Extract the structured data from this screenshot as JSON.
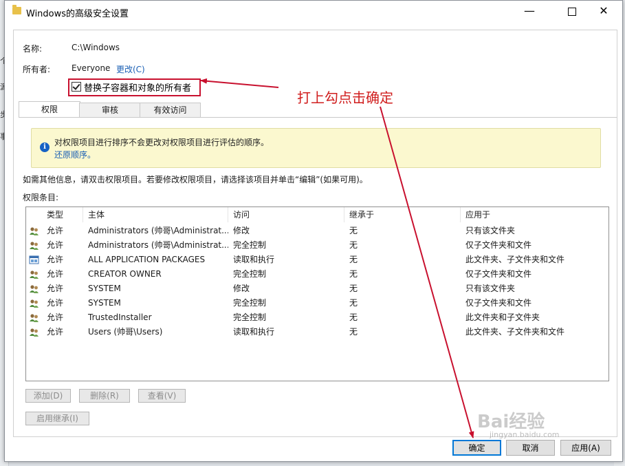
{
  "window": {
    "title": "Windows的高级安全设置",
    "controls": {
      "minimize": "—",
      "close": "✕"
    }
  },
  "background_fragments": [
    "个",
    "源",
    "步",
    "事"
  ],
  "header": {
    "name_label": "名称:",
    "name_value": "C:\\Windows",
    "owner_label": "所有者:",
    "owner_value": "Everyone",
    "change_link": "更改(C)",
    "replace_owner_checkbox": {
      "label": "替换子容器和对象的所有者",
      "checked": true
    }
  },
  "tabs": [
    {
      "label": "权限",
      "active": true
    },
    {
      "label": "审核",
      "active": false
    },
    {
      "label": "有效访问",
      "active": false
    }
  ],
  "info_box": {
    "icon": "info-icon",
    "text": "对权限项目进行排序不会更改对权限项目进行评估的顺序。",
    "link": "还原顺序。"
  },
  "instructions": "如需其他信息，请双击权限项目。若要修改权限项目，请选择该项目并单击“编辑”(如果可用)。",
  "entries_label": "权限条目:",
  "table": {
    "columns": [
      "类型",
      "主体",
      "访问",
      "继承于",
      "应用于"
    ],
    "rows": [
      {
        "icon": "user-group-icon",
        "type": "允许",
        "principal": "Administrators (帅哥\\Administrat...",
        "access": "修改",
        "inherited": "无",
        "applies": "只有该文件夹"
      },
      {
        "icon": "user-group-icon",
        "type": "允许",
        "principal": "Administrators (帅哥\\Administrat...",
        "access": "完全控制",
        "inherited": "无",
        "applies": "仅子文件夹和文件"
      },
      {
        "icon": "app-package-icon",
        "type": "允许",
        "principal": "ALL APPLICATION PACKAGES",
        "access": "读取和执行",
        "inherited": "无",
        "applies": "此文件夹、子文件夹和文件"
      },
      {
        "icon": "user-group-icon",
        "type": "允许",
        "principal": "CREATOR OWNER",
        "access": "完全控制",
        "inherited": "无",
        "applies": "仅子文件夹和文件"
      },
      {
        "icon": "user-group-icon",
        "type": "允许",
        "principal": "SYSTEM",
        "access": "修改",
        "inherited": "无",
        "applies": "只有该文件夹"
      },
      {
        "icon": "user-group-icon",
        "type": "允许",
        "principal": "SYSTEM",
        "access": "完全控制",
        "inherited": "无",
        "applies": "仅子文件夹和文件"
      },
      {
        "icon": "user-group-icon",
        "type": "允许",
        "principal": "TrustedInstaller",
        "access": "完全控制",
        "inherited": "无",
        "applies": "此文件夹和子文件夹"
      },
      {
        "icon": "user-group-icon",
        "type": "允许",
        "principal": "Users (帅哥\\Users)",
        "access": "读取和执行",
        "inherited": "无",
        "applies": "此文件夹、子文件夹和文件"
      }
    ]
  },
  "buttons": {
    "add": "添加(D)",
    "remove": "删除(R)",
    "view": "查看(V)",
    "enable_inheritance": "启用继承(I)",
    "ok": "确定",
    "cancel": "取消",
    "apply": "应用(A)"
  },
  "annotation": {
    "text": "打上勾点击确定",
    "color": "#d01d1d"
  },
  "watermark": {
    "text": "Bai经验",
    "sub": "jingyan.baidu.com"
  },
  "colors": {
    "accent": "#0078d7",
    "link": "#1a5fb4",
    "info_bg": "#fbf8cf",
    "annotation_red": "#c8102e"
  }
}
